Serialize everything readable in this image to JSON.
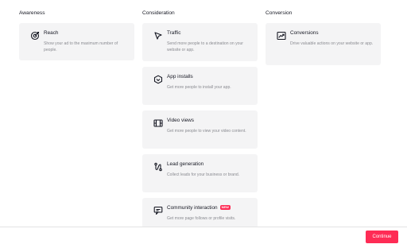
{
  "columns": {
    "awareness": {
      "title": "Awareness",
      "cards": [
        {
          "icon": "target-icon",
          "title": "Reach",
          "description": "Show your ad to the maximum number of people."
        }
      ]
    },
    "consideration": {
      "title": "Consideration",
      "cards": [
        {
          "icon": "cursor-arrow-icon",
          "title": "Traffic",
          "description": "Send more people to a destination on your website or app."
        },
        {
          "icon": "app-box-icon",
          "title": "App installs",
          "description": "Get more people to install your app."
        },
        {
          "icon": "film-icon",
          "title": "Video views",
          "description": "Get more people to view your video content."
        },
        {
          "icon": "funnel-path-icon",
          "title": "Lead generation",
          "description": "Collect leads for your business or brand."
        },
        {
          "icon": "community-icon",
          "title": "Community interaction",
          "badge": "NEW",
          "description": "Get more page follows or profile visits."
        }
      ]
    },
    "conversion": {
      "title": "Conversion",
      "cards": [
        {
          "icon": "trend-chart-icon",
          "title": "Conversions",
          "description": "Drive valuable actions on your website or app."
        }
      ]
    }
  },
  "footer": {
    "continue_label": "Continue"
  },
  "colors": {
    "accent": "#fe2c55",
    "card_bg": "#f4f4f5",
    "muted_text": "#8a8b91"
  }
}
